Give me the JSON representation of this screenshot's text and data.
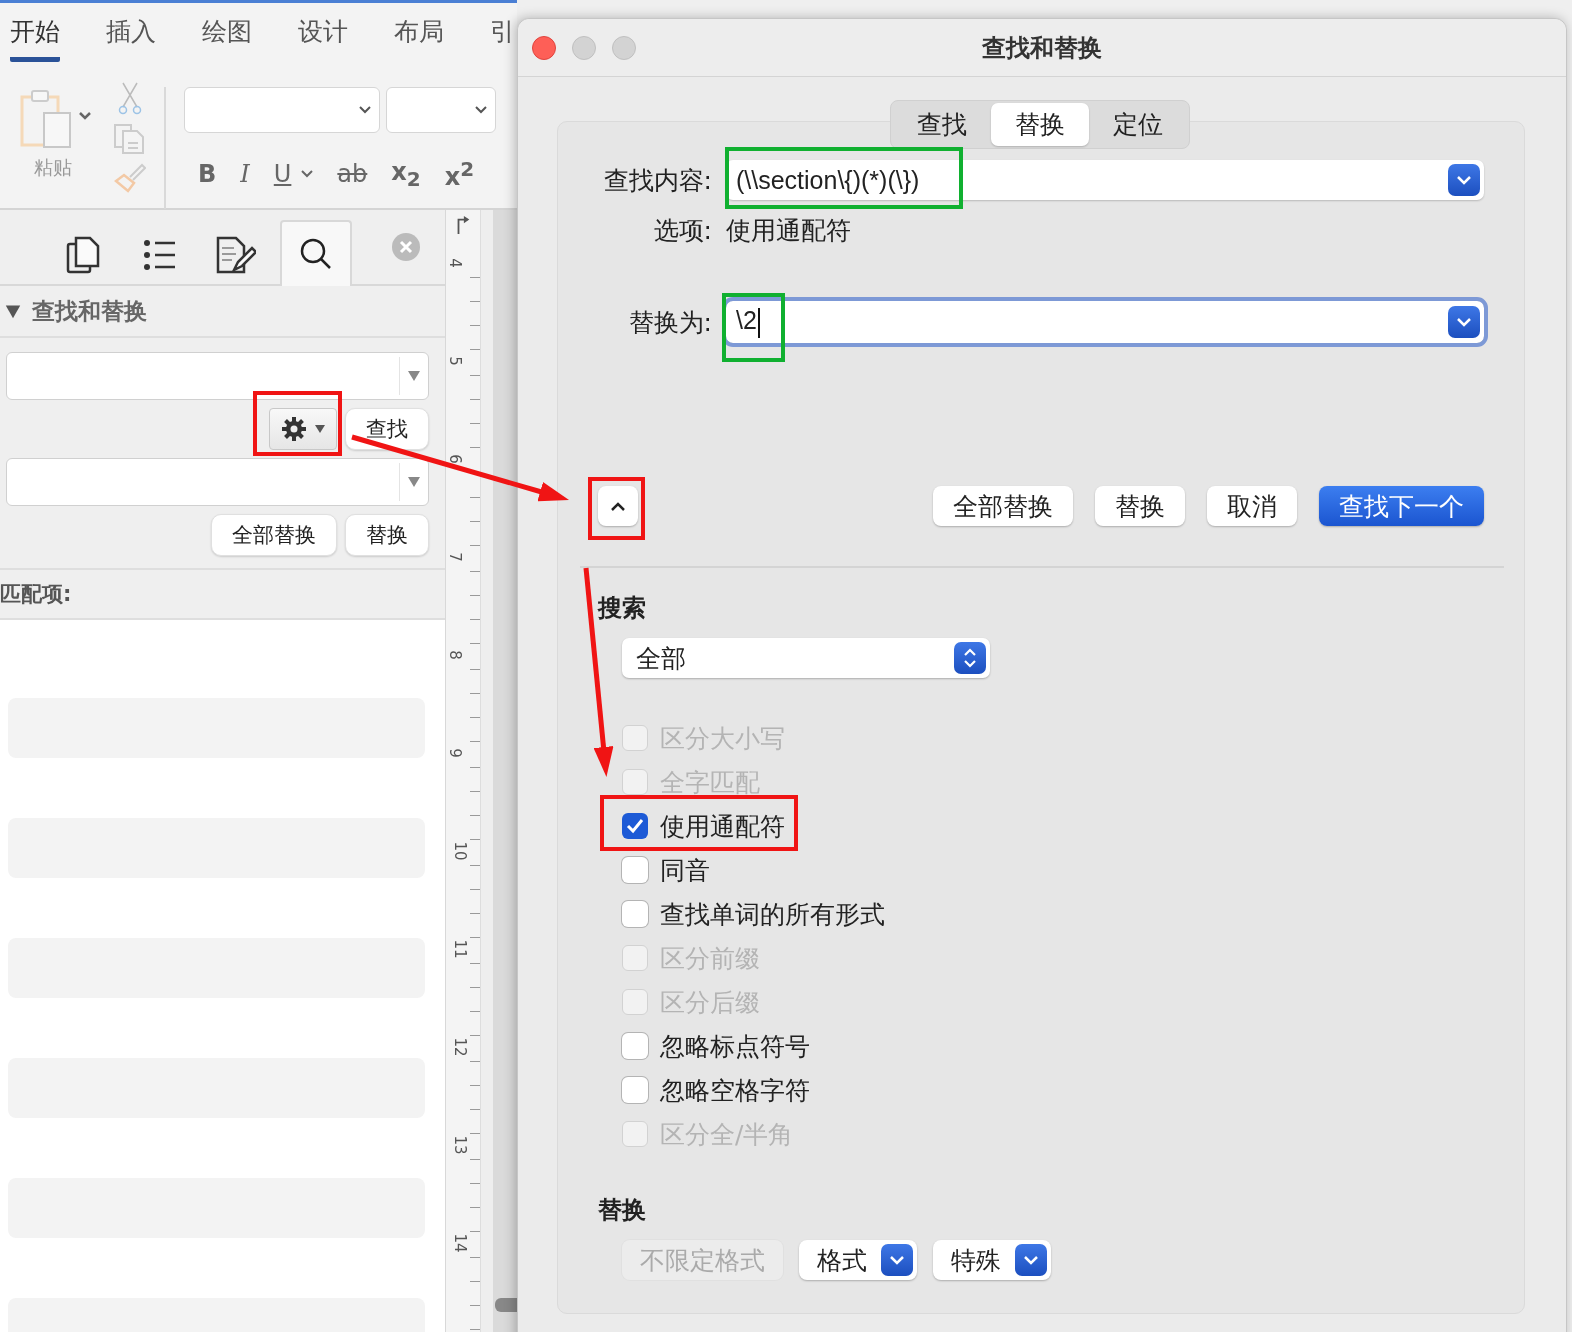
{
  "ribbon": {
    "tabs": [
      {
        "label": "开始",
        "selected": true
      },
      {
        "label": "插入",
        "selected": false
      },
      {
        "label": "绘图",
        "selected": false
      },
      {
        "label": "设计",
        "selected": false
      },
      {
        "label": "布局",
        "selected": false
      },
      {
        "label": "引",
        "selected": false
      }
    ],
    "paste_label": "粘贴",
    "format_buttons": [
      {
        "kind": "bold",
        "label": "B"
      },
      {
        "kind": "italic",
        "label": "I"
      },
      {
        "kind": "underline",
        "label": "U"
      },
      {
        "kind": "strike",
        "label": "ab"
      },
      {
        "kind": "sub",
        "label": "x$_{2}$"
      },
      {
        "kind": "sup",
        "label": "x$^{2}$"
      }
    ]
  },
  "sidebar": {
    "panel_tabs": [
      {
        "kind": "pages",
        "selected": false
      },
      {
        "kind": "outline",
        "selected": false
      },
      {
        "kind": "edit",
        "selected": false
      },
      {
        "kind": "search",
        "selected": true
      }
    ],
    "section_title": "查找和替换",
    "expanded": true,
    "find_button": "查找",
    "replace_buttons": [
      "全部替换",
      "替换"
    ],
    "matches_label": "匹配项:"
  },
  "ruler": {
    "marks": [
      "4",
      "5",
      "6",
      "7",
      "8",
      "9",
      "10",
      "11",
      "12",
      "13",
      "14"
    ]
  },
  "dialog": {
    "title": "查找和替换",
    "tabs": [
      {
        "label": "查找",
        "selected": false
      },
      {
        "label": "替换",
        "selected": true
      },
      {
        "label": "定位",
        "selected": false
      }
    ],
    "find_label": "查找内容:",
    "find_value": "(\\\\section\\{)(*)(\\})",
    "options_label": "选项:",
    "options_value": "使用通配符",
    "replace_label": "替换为:",
    "replace_value": "\\2",
    "buttons": [
      {
        "label": "全部替换",
        "kind": "normal"
      },
      {
        "label": "替换",
        "kind": "normal"
      },
      {
        "label": "取消",
        "kind": "normal"
      },
      {
        "label": "查找下一个",
        "kind": "default"
      }
    ],
    "search_label": "搜索",
    "search_scope": "全部",
    "checkboxes": [
      {
        "label": "区分大小写",
        "checked": false,
        "disabled": true
      },
      {
        "label": "全字匹配",
        "checked": false,
        "disabled": true
      },
      {
        "label": "使用通配符",
        "checked": true,
        "disabled": false
      },
      {
        "label": "同音",
        "checked": false,
        "disabled": false
      },
      {
        "label": "查找单词的所有形式",
        "checked": false,
        "disabled": false
      },
      {
        "label": "区分前缀",
        "checked": false,
        "disabled": true
      },
      {
        "label": "区分后缀",
        "checked": false,
        "disabled": true
      },
      {
        "label": "忽略标点符号",
        "checked": false,
        "disabled": false
      },
      {
        "label": "忽略空格字符",
        "checked": false,
        "disabled": false
      },
      {
        "label": "区分全/半角",
        "checked": false,
        "disabled": true
      }
    ],
    "replace_section": "替换",
    "format_buttons": [
      {
        "label": "不限定格式",
        "disabled": true,
        "menu": false
      },
      {
        "label": "格式",
        "disabled": false,
        "menu": true
      },
      {
        "label": "特殊",
        "disabled": false,
        "menu": true
      }
    ]
  }
}
